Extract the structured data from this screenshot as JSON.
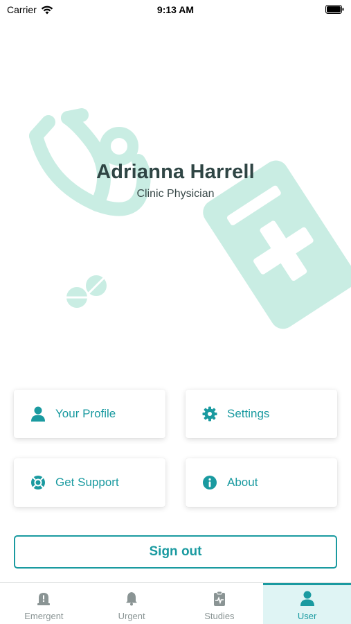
{
  "status_bar": {
    "carrier": "Carrier",
    "time": "9:13 AM"
  },
  "user": {
    "name": "Adrianna Harrell",
    "role": "Clinic Physician"
  },
  "menu": {
    "profile": {
      "label": "Your Profile",
      "icon": "user-icon"
    },
    "settings": {
      "label": "Settings",
      "icon": "gear-icon"
    },
    "support": {
      "label": "Get Support",
      "icon": "lifebuoy-icon"
    },
    "about": {
      "label": "About",
      "icon": "info-icon"
    }
  },
  "sign_out_label": "Sign out",
  "tabs": [
    {
      "label": "Emergent",
      "icon": "siren-icon",
      "active": false
    },
    {
      "label": "Urgent",
      "icon": "bell-icon",
      "active": false
    },
    {
      "label": "Studies",
      "icon": "clipboard-pulse-icon",
      "active": false
    },
    {
      "label": "User",
      "icon": "user-icon",
      "active": true
    }
  ],
  "colors": {
    "accent": "#1a9aa0",
    "illustration": "#c9ede3",
    "active_tab_bg": "#dff4f4",
    "name_text": "#2f4544"
  }
}
